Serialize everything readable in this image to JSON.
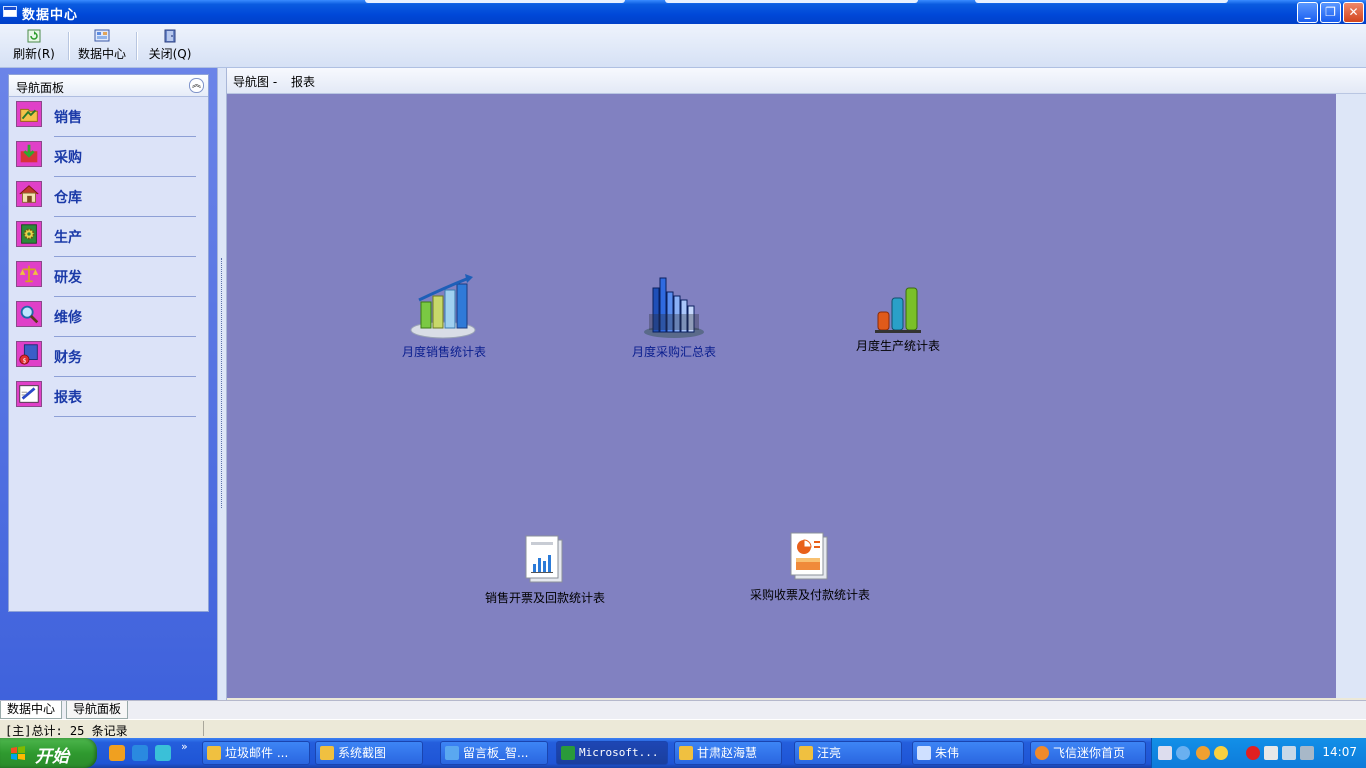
{
  "window": {
    "title": "数据中心"
  },
  "toolbar": {
    "refresh": "刷新(R)",
    "data_center": "数据中心",
    "close": "关闭(Q)"
  },
  "nav_panel": {
    "header": "导航面板",
    "items": [
      {
        "label": "销售",
        "icon": "sales-folder-icon"
      },
      {
        "label": "采购",
        "icon": "purchase-icon"
      },
      {
        "label": "仓库",
        "icon": "warehouse-house-icon"
      },
      {
        "label": "生产",
        "icon": "production-gear-icon"
      },
      {
        "label": "研发",
        "icon": "rnd-scale-icon"
      },
      {
        "label": "维修",
        "icon": "repair-magnifier-icon"
      },
      {
        "label": "财务",
        "icon": "finance-money-icon"
      },
      {
        "label": "报表",
        "icon": "report-pen-icon"
      }
    ]
  },
  "breadcrumb": {
    "prefix": "导航图 -",
    "current": "报表"
  },
  "reports": [
    {
      "label": "月度销售统计表",
      "icon": "bar-chart-growth-icon"
    },
    {
      "label": "月度采购汇总表",
      "icon": "skyline-chart-icon"
    },
    {
      "label": "月度生产统计表",
      "icon": "colored-bars-icon"
    },
    {
      "label": "销售开票及回款统计表",
      "icon": "document-chart-icon"
    },
    {
      "label": "采购收票及付款统计表",
      "icon": "document-pie-icon"
    }
  ],
  "bottom_tabs": [
    "数据中心",
    "导航面板"
  ],
  "status": "[主]总计: 25 条记录",
  "taskbar": {
    "start": "开始",
    "tasks": [
      "垃圾邮件 ...",
      "系统截图",
      "留言板_智...",
      "Microsoft...",
      "甘肃赵海慧",
      "汪亮",
      "朱伟",
      "飞信迷你首页"
    ],
    "clock": "14:07"
  },
  "colors": {
    "titlebar": "#0048D8",
    "canvas": "#8181C1",
    "nav_text": "#1B3AA8",
    "report_blue_text": "#0A1E8E"
  }
}
